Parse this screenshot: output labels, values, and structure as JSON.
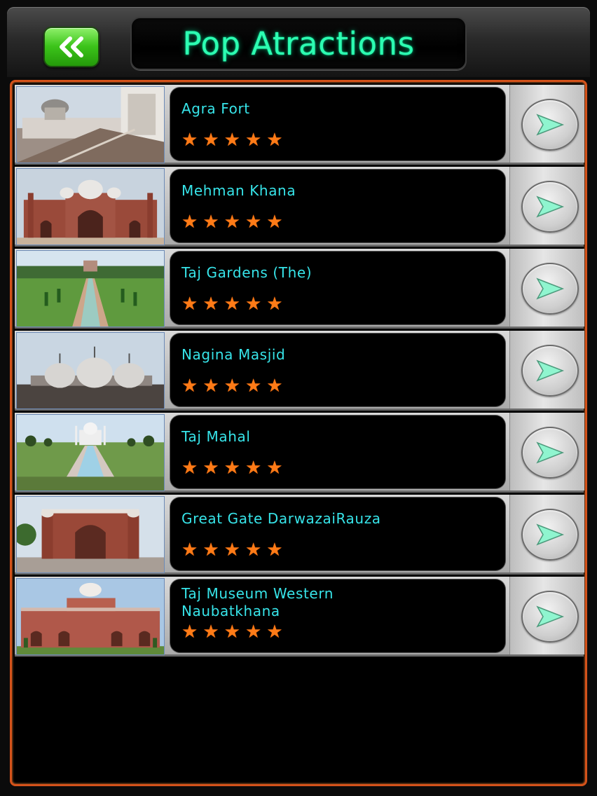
{
  "header": {
    "title": "Pop Atractions",
    "back_icon": "double-chevron-left-icon",
    "back_color": "#3cc41a",
    "title_color": "#2dffb2"
  },
  "accent": {
    "frame": "#d4521a",
    "star": "#ff7b17",
    "name": "#37e4e9"
  },
  "attractions": [
    {
      "name": "Agra Fort",
      "rating": 5,
      "photo": "agra-fort-photo"
    },
    {
      "name": "Mehman Khana",
      "rating": 5,
      "photo": "mehman-khana-photo"
    },
    {
      "name": "Taj Gardens (The)",
      "rating": 5,
      "photo": "taj-gardens-photo"
    },
    {
      "name": "Nagina Masjid",
      "rating": 5,
      "photo": "nagina-masjid-photo"
    },
    {
      "name": "Taj Mahal",
      "rating": 5,
      "photo": "taj-mahal-photo"
    },
    {
      "name": "Great Gate DarwazaiRauza",
      "rating": 5,
      "photo": "great-gate-photo"
    },
    {
      "name": "Taj Museum Western Naubatkhana",
      "rating": 5,
      "photo": "taj-museum-photo"
    }
  ]
}
